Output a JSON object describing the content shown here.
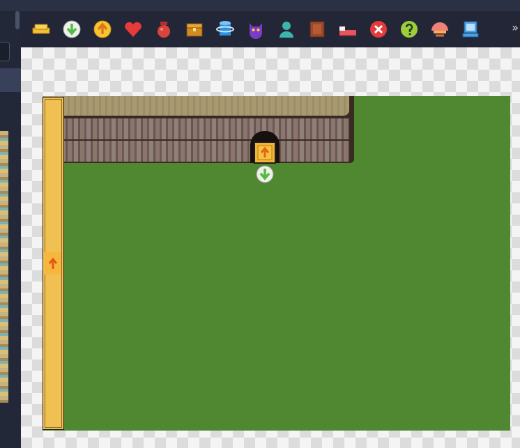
{
  "toolbar": {
    "tools": [
      {
        "name": "gold-bars-icon",
        "color": "#f2c232"
      },
      {
        "name": "arrow-down-icon",
        "color": "#55b947"
      },
      {
        "name": "arrow-up-icon",
        "color": "#f0a81c"
      },
      {
        "name": "heart-icon",
        "color": "#e53b3b"
      },
      {
        "name": "potion-jar-icon",
        "color": "#d9453c"
      },
      {
        "name": "treasure-chest-icon",
        "color": "#d28a22"
      },
      {
        "name": "warp-cylinder-icon",
        "color": "#2f8fe0"
      },
      {
        "name": "demon-mask-icon",
        "color": "#7a3cc7"
      },
      {
        "name": "npc-person-icon",
        "color": "#3fb4ac"
      },
      {
        "name": "door-icon",
        "color": "#9a4a2c"
      },
      {
        "name": "bed-icon",
        "color": "#e4565a"
      },
      {
        "name": "close-x-icon",
        "color": "#e33a3a"
      },
      {
        "name": "question-icon",
        "color": "#9dcc3c"
      },
      {
        "name": "shell-icon",
        "color": "#f0817a"
      },
      {
        "name": "computer-icon",
        "color": "#4ba0e6"
      }
    ],
    "more_label": "»"
  },
  "map": {
    "ground_color": "#4f8831",
    "events": {
      "ladder": "arrow-up-icon",
      "door": "arrow-up-icon",
      "start": "arrow-down-icon"
    }
  }
}
